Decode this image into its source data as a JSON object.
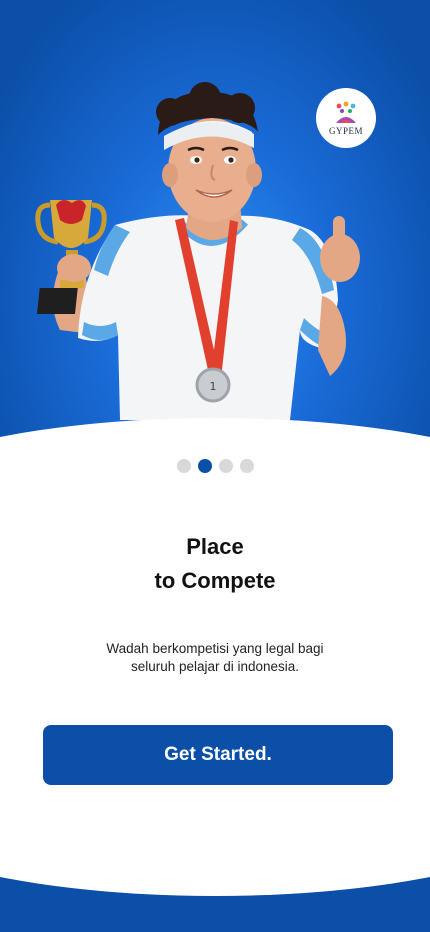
{
  "brand": {
    "logo_text": "GYPEM"
  },
  "onboarding": {
    "pages": 4,
    "current_page": 2,
    "title_line1": "Place",
    "title_line2": "to Compete",
    "description_line1": "Wadah berkompetisi yang legal bagi",
    "description_line2": "seluruh pelajar di indonesia.",
    "cta_label": "Get Started."
  },
  "colors": {
    "primary": "#0b4fa8",
    "hero_light": "#2f8ff0",
    "dot_inactive": "#d9d9d9",
    "panel": "#ffffff"
  },
  "icons": {
    "hero": "trophy-athlete-illustration",
    "logo": "gypem-logo-icon"
  }
}
